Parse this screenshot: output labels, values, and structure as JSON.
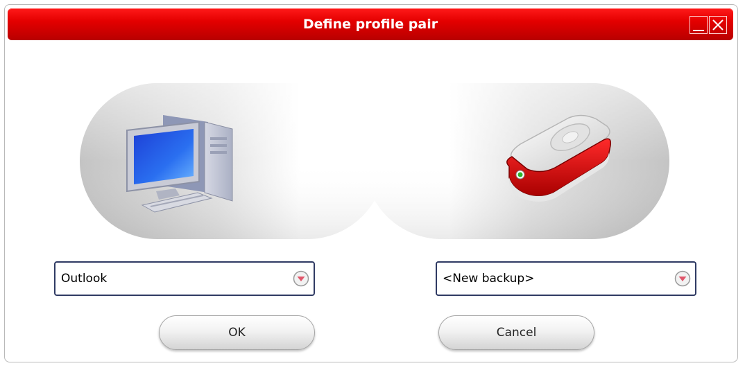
{
  "window": {
    "title": "Define profile pair"
  },
  "source": {
    "icon": "desktop-computer-icon",
    "selected": "Outlook"
  },
  "destination": {
    "icon": "external-hard-drive-icon",
    "selected": "<New backup>"
  },
  "buttons": {
    "ok_label": "OK",
    "cancel_label": "Cancel"
  },
  "colors": {
    "titlebar": "#d80000",
    "dropdown_border": "#2f3a63",
    "drive_accent": "#cc0000"
  }
}
